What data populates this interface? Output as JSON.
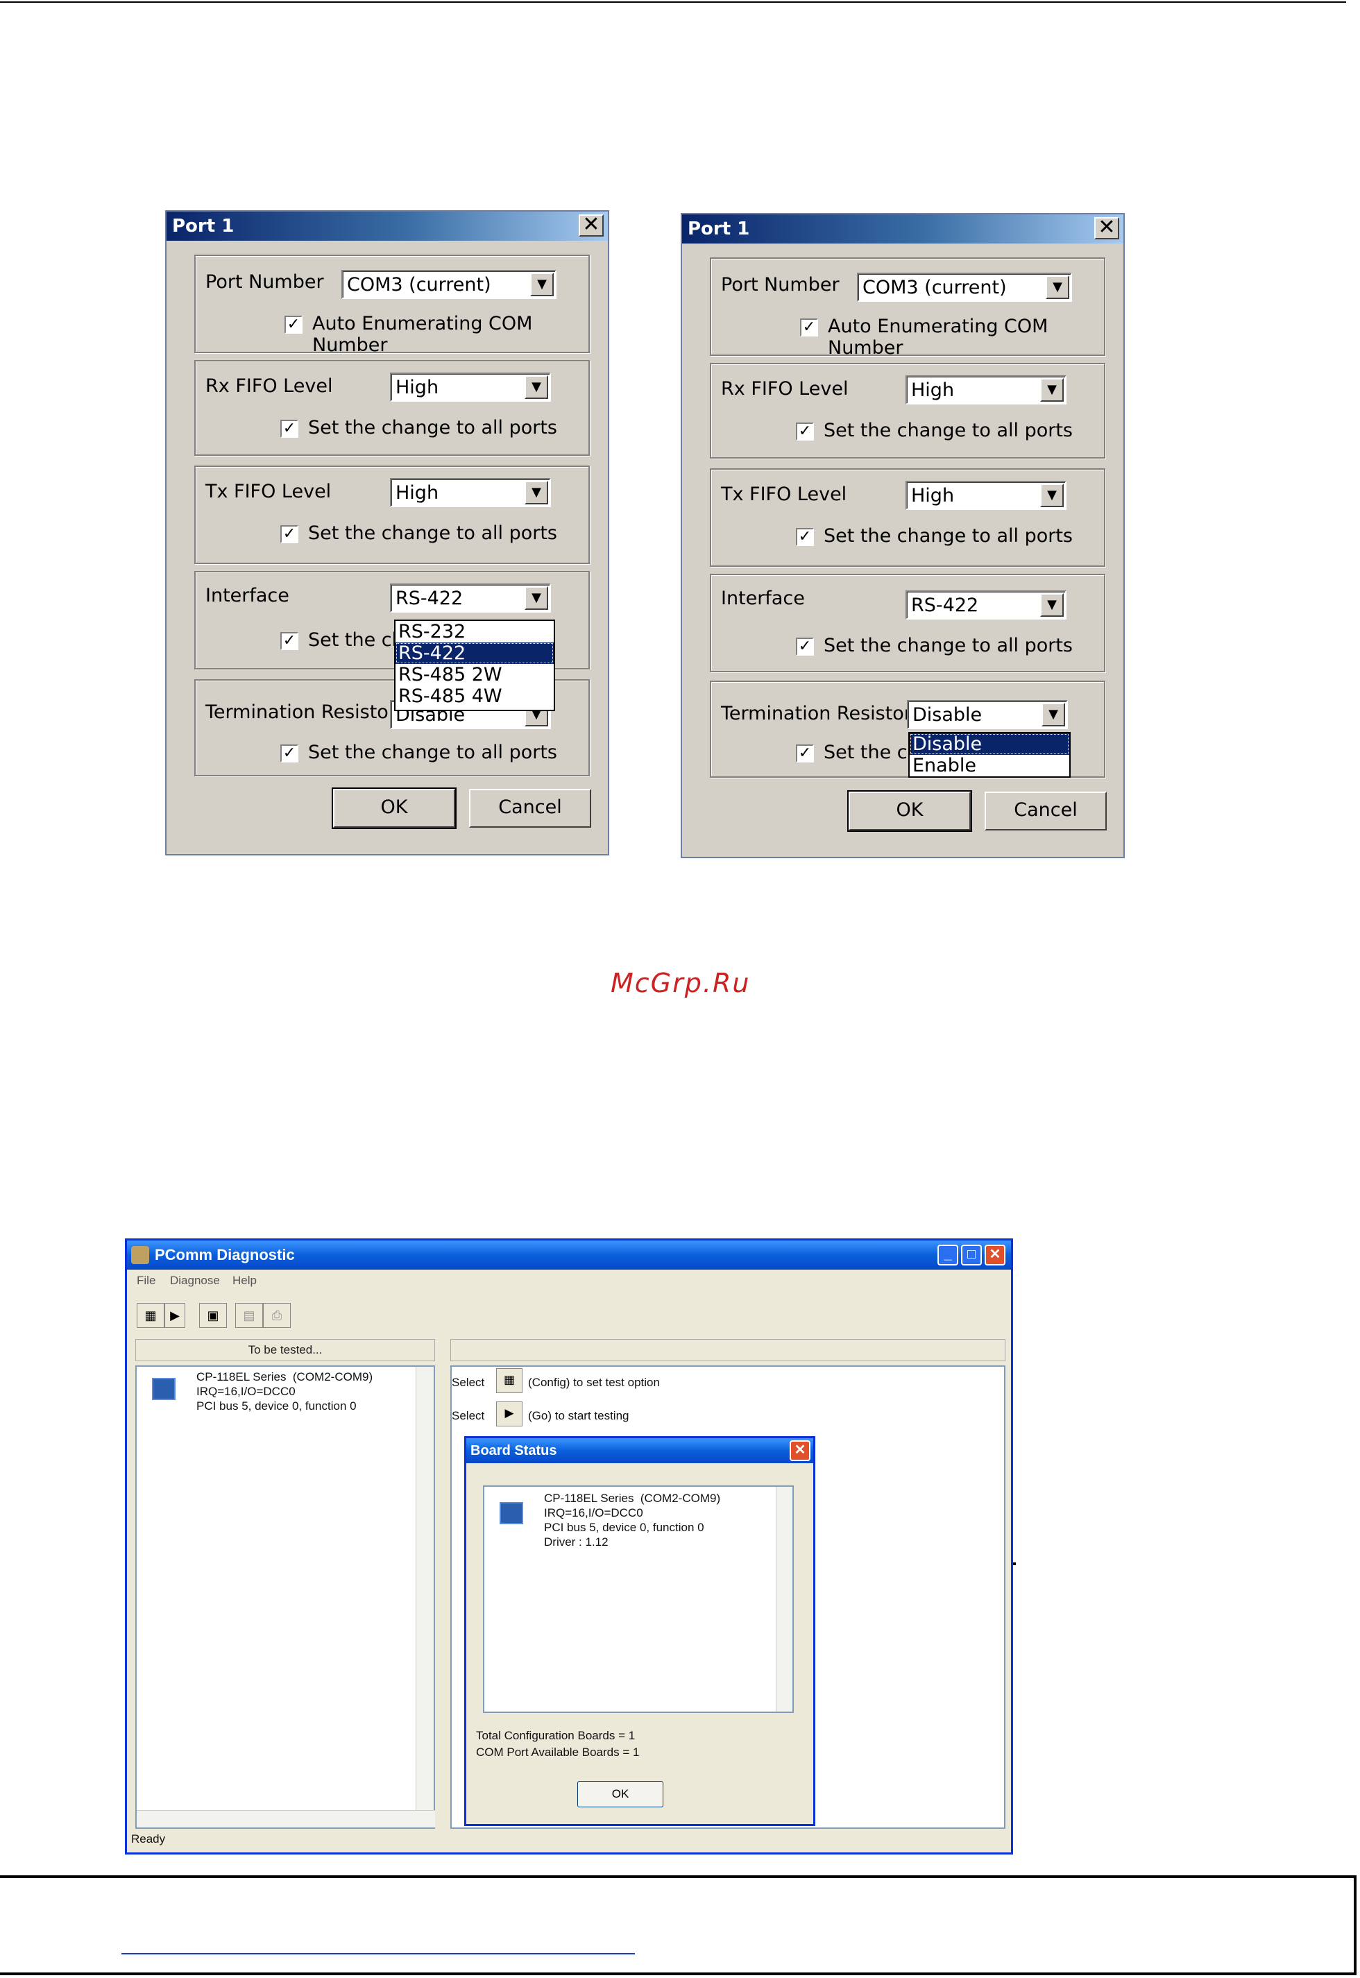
{
  "dialog_left": {
    "title": "Port 1",
    "port_number_label": "Port Number",
    "port_number_value": "COM3 (current)",
    "auto_enum_label": "Auto Enumerating COM Number",
    "rx_label": "Rx FIFO Level",
    "rx_value": "High",
    "rx_apply": "Set the change to all ports",
    "tx_label": "Tx FIFO Level",
    "tx_value": "High",
    "tx_apply": "Set the change to all ports",
    "interface_label": "Interface",
    "interface_value": "RS-422",
    "interface_apply_partial": "Set the ch",
    "interface_options": [
      "RS-232",
      "RS-422",
      "RS-485 2W",
      "RS-485 4W"
    ],
    "interface_selected_index": 1,
    "term_label": "Termination Resistor",
    "term_value": "Disable",
    "term_apply": "Set the change to all ports",
    "ok": "OK",
    "cancel": "Cancel"
  },
  "dialog_right": {
    "title": "Port 1",
    "port_number_label": "Port Number",
    "port_number_value": "COM3 (current)",
    "auto_enum_label": "Auto Enumerating COM Number",
    "rx_label": "Rx FIFO Level",
    "rx_value": "High",
    "rx_apply": "Set the change to all ports",
    "tx_label": "Tx FIFO Level",
    "tx_value": "High",
    "tx_apply": "Set the change to all ports",
    "interface_label": "Interface",
    "interface_value": "RS-422",
    "interface_apply": "Set the change to all ports",
    "term_label": "Termination Resistor",
    "term_value": "Disable",
    "term_apply_partial": "Set the ch",
    "term_options": [
      "Disable",
      "Enable"
    ],
    "term_selected_index": 0,
    "ok": "OK",
    "cancel": "Cancel"
  },
  "watermark": "McGrp.Ru",
  "pcomm": {
    "title": "PComm Diagnostic",
    "menu": [
      "File",
      "Diagnose",
      "Help"
    ],
    "left_header": "To be tested...",
    "board_text": "CP-118EL Series  (COM2-COM9)\nIRQ=16,I/O=DCC0\nPCI bus 5, device 0, function 0",
    "select_word": "Select",
    "config_hint": "(Config) to set test option",
    "go_hint": "(Go) to start testing",
    "status": "Ready",
    "board_status": {
      "title": "Board Status",
      "board_text": "CP-118EL Series  (COM2-COM9)\nIRQ=16,I/O=DCC0\nPCI bus 5, device 0, function 0\nDriver : 1.12",
      "total_boards": "Total Configuration Boards = 1",
      "available_boards": "COM Port Available Boards = 1",
      "ok": "OK"
    }
  },
  "colors": {
    "classic_title_start": "#0a246a",
    "xp_title": "#0a5fdb",
    "dialog_face": "#d4d0c8",
    "xp_face": "#ece9d8",
    "watermark": "#cc2222"
  }
}
